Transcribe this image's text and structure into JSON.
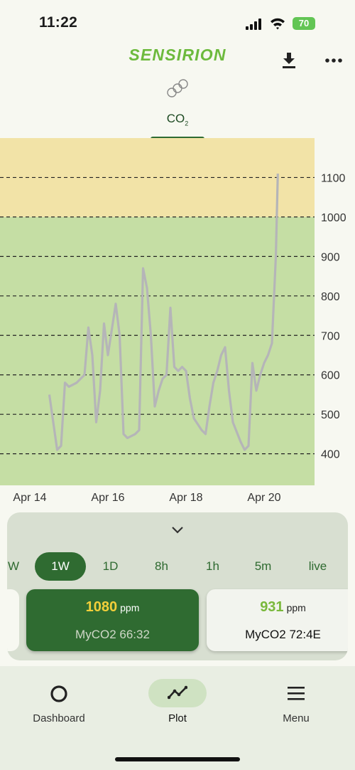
{
  "status_bar": {
    "time": "11:22",
    "battery": "70"
  },
  "header": {
    "logo": "SENSIRION"
  },
  "tabs": [
    {
      "label": "CO",
      "subscript": "2"
    }
  ],
  "chart_data": {
    "type": "line",
    "ylim": [
      320,
      1200
    ],
    "y_ticks": [
      400,
      500,
      600,
      700,
      800,
      900,
      1000,
      1100
    ],
    "x_ticks": [
      {
        "label": "Apr 14",
        "day": 14
      },
      {
        "label": "Apr 16",
        "day": 16
      },
      {
        "label": "Apr 18",
        "day": 18
      },
      {
        "label": "Apr 20",
        "day": 20
      }
    ],
    "zones": [
      {
        "from": 1000,
        "to": 1200,
        "color": "#f2e3a7"
      },
      {
        "from": 320,
        "to": 1000,
        "color": "#c5dea4"
      }
    ],
    "grid": "dashed",
    "line_color": "#b5b5b8",
    "series": [
      {
        "points": [
          [
            14.5,
            550
          ],
          [
            14.6,
            480
          ],
          [
            14.7,
            410
          ],
          [
            14.8,
            420
          ],
          [
            14.9,
            580
          ],
          [
            15.0,
            570
          ],
          [
            15.2,
            580
          ],
          [
            15.4,
            600
          ],
          [
            15.5,
            720
          ],
          [
            15.6,
            650
          ],
          [
            15.7,
            480
          ],
          [
            15.8,
            560
          ],
          [
            15.9,
            730
          ],
          [
            16.0,
            650
          ],
          [
            16.2,
            780
          ],
          [
            16.3,
            700
          ],
          [
            16.4,
            450
          ],
          [
            16.5,
            440
          ],
          [
            16.7,
            450
          ],
          [
            16.8,
            460
          ],
          [
            16.9,
            870
          ],
          [
            17.0,
            820
          ],
          [
            17.1,
            700
          ],
          [
            17.2,
            520
          ],
          [
            17.3,
            560
          ],
          [
            17.4,
            590
          ],
          [
            17.5,
            600
          ],
          [
            17.6,
            770
          ],
          [
            17.7,
            620
          ],
          [
            17.8,
            610
          ],
          [
            17.9,
            620
          ],
          [
            18.0,
            610
          ],
          [
            18.1,
            540
          ],
          [
            18.2,
            490
          ],
          [
            18.4,
            460
          ],
          [
            18.5,
            450
          ],
          [
            18.6,
            520
          ],
          [
            18.7,
            580
          ],
          [
            18.8,
            610
          ],
          [
            18.9,
            650
          ],
          [
            19.0,
            670
          ],
          [
            19.1,
            560
          ],
          [
            19.2,
            480
          ],
          [
            19.4,
            430
          ],
          [
            19.5,
            410
          ],
          [
            19.6,
            420
          ],
          [
            19.7,
            630
          ],
          [
            19.8,
            560
          ],
          [
            19.9,
            600
          ],
          [
            20.0,
            630
          ],
          [
            20.1,
            650
          ],
          [
            20.2,
            680
          ],
          [
            20.3,
            900
          ],
          [
            20.35,
            1110
          ]
        ]
      }
    ],
    "legend": "none"
  },
  "ranges": [
    "W",
    "1W",
    "1D",
    "8h",
    "1h",
    "5m",
    "live"
  ],
  "active_range": "1W",
  "devices": [
    {
      "value": "1080",
      "unit": "ppm",
      "name": "MyCO2 66:32",
      "value_color": "#f2cf3a"
    },
    {
      "value": "931",
      "unit": "ppm",
      "name": "MyCO2 72:4E",
      "value_color": "#79b83b"
    }
  ],
  "nav": [
    {
      "label": "Dashboard",
      "icon": "circle-icon"
    },
    {
      "label": "Plot",
      "icon": "line-chart-icon"
    },
    {
      "label": "Menu",
      "icon": "hamburger-menu-icon"
    }
  ],
  "colors": {
    "brand": "#6dba3d",
    "primary": "#2f6b31"
  }
}
